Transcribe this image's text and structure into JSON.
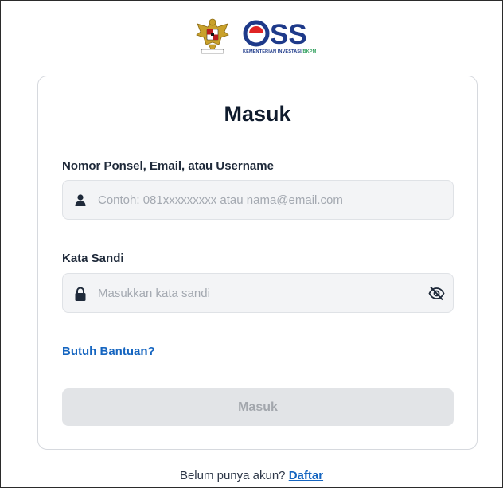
{
  "header": {
    "emblem_icon": "garuda-pancasila-emblem",
    "brand_name": "OSS",
    "brand_subtitle_1": "KEMENTERIAN INVESTASI/",
    "brand_subtitle_2": "BKPM",
    "colors": {
      "brand_blue": "#1e3a8a",
      "brand_red": "#e02424",
      "subtitle_green": "#2e9e5b"
    }
  },
  "login": {
    "title": "Masuk",
    "username": {
      "label": "Nomor Ponsel, Email, atau Username",
      "placeholder": "Contoh: 081xxxxxxxxx atau nama@email.com",
      "value": "",
      "icon": "user-icon"
    },
    "password": {
      "label": "Kata Sandi",
      "placeholder": "Masukkan kata sandi",
      "value": "",
      "icon": "lock-icon",
      "toggle_icon": "eye-off-icon"
    },
    "help_link": "Butuh Bantuan?",
    "submit_label": "Masuk"
  },
  "footer": {
    "prompt": "Belum punya akun?",
    "register_link": "Daftar"
  },
  "colors": {
    "link": "#1565c0",
    "title": "#0f1b2d",
    "button_disabled_bg": "#e2e4e7"
  }
}
